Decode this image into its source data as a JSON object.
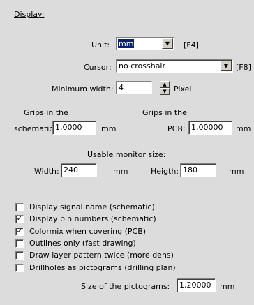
{
  "section_title": "Display:",
  "unit": {
    "label": "Unit:",
    "value": "mm",
    "shortcut": "[F4]"
  },
  "cursor": {
    "label": "Cursor:",
    "value": "no crosshair",
    "shortcut": "[F8]"
  },
  "min_width": {
    "label": "Minimum width:",
    "value": "4",
    "unit": "Pixel"
  },
  "grips_schematic": {
    "label_line1": "Grips in the",
    "label_line2": "schematic:",
    "value": "1,0000",
    "unit": "mm"
  },
  "grips_pcb": {
    "label_line1": "Grips in the",
    "label_line2": "PCB:",
    "value": "1,00000",
    "unit": "mm"
  },
  "monitor": {
    "title": "Usable monitor size:",
    "width_label": "Width:",
    "width_value": "240",
    "width_unit": "mm",
    "height_label": "Heigth:",
    "height_value": "180",
    "height_unit": "mm"
  },
  "checkboxes": [
    {
      "label": "Display signal name (schematic)",
      "checked": false
    },
    {
      "label": "Display pin numbers (schematic)",
      "checked": true
    },
    {
      "label": "Colormix when covering (PCB)",
      "checked": true
    },
    {
      "label": "Outlines only (fast drawing)",
      "checked": false
    },
    {
      "label": "Draw layer pattern twice (more dens)",
      "checked": false
    },
    {
      "label": "Drillholes as pictograms (drilling plan)",
      "checked": false
    }
  ],
  "pictogram_size": {
    "label": "Size of the pictograms:",
    "value": "1,20000",
    "unit": "mm"
  },
  "icons": {
    "dropdown": "chevron-down-icon",
    "spin_up": "spin-up-icon",
    "spin_down": "spin-down-icon",
    "check": "check-icon"
  }
}
